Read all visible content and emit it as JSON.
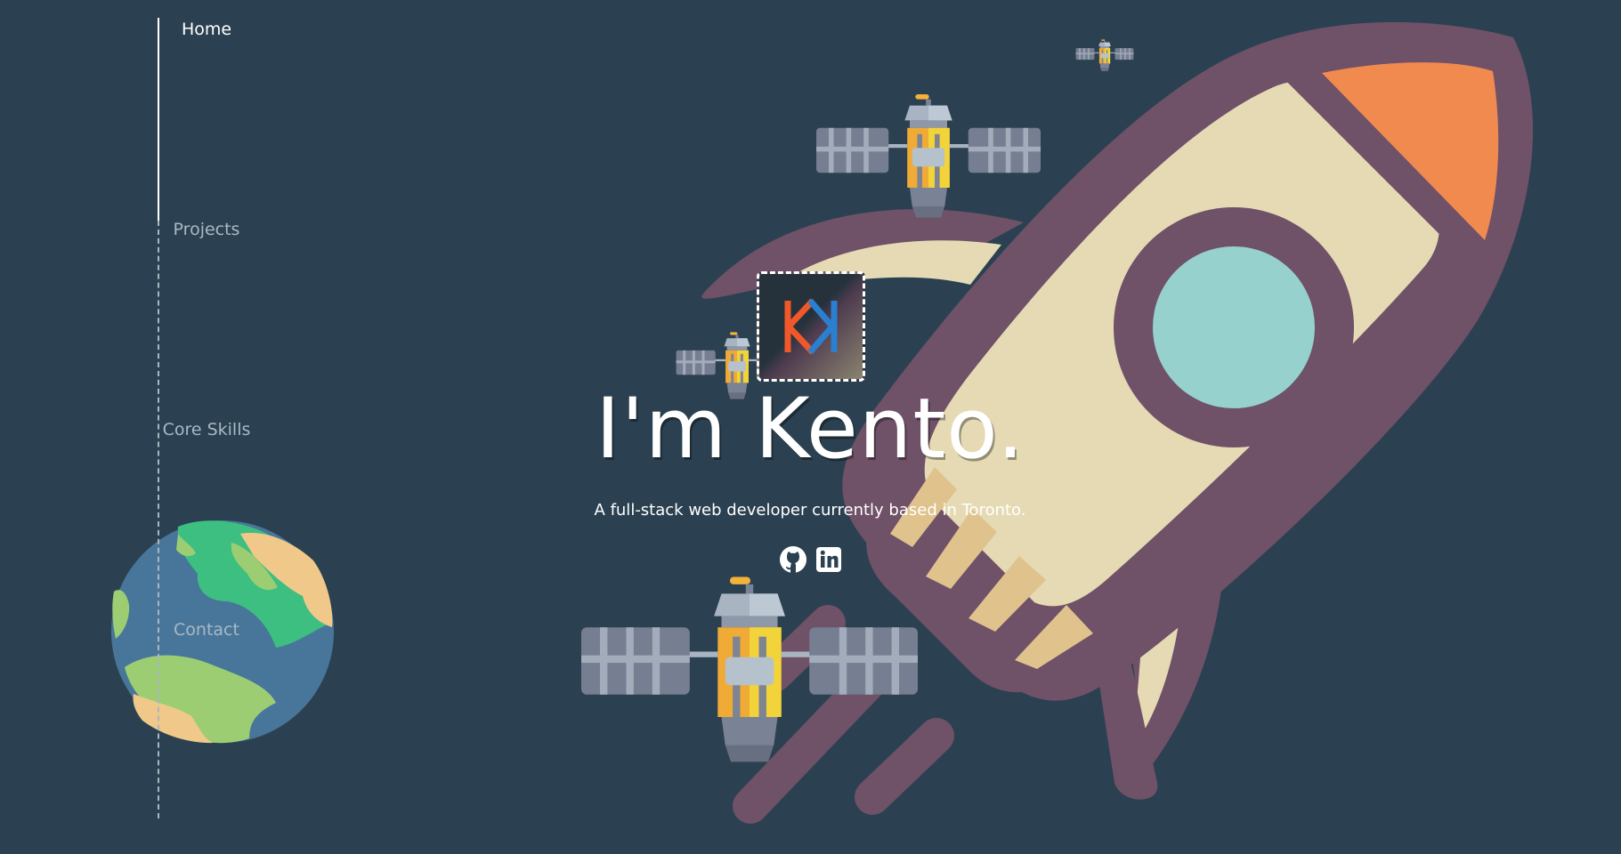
{
  "nav": {
    "items": [
      {
        "label": "Home",
        "active": true
      },
      {
        "label": "Projects",
        "active": false
      },
      {
        "label": "Core Skills",
        "active": false
      },
      {
        "label": "Contact",
        "active": false
      }
    ]
  },
  "hero": {
    "logo_text": "KK",
    "title": "I'm Kento.",
    "subtitle": "A full-stack web developer currently based in Toronto."
  },
  "social": [
    {
      "icon": "github-icon"
    },
    {
      "icon": "linkedin-icon"
    }
  ],
  "colors": {
    "background": "#2b4151",
    "rocket_body": "#6f5168",
    "rocket_cream": "#e5dab4",
    "rocket_window": "#96d1cd",
    "rocket_tip": "#f08a4f",
    "logo_k_orange": "#f0582a",
    "logo_k_blue": "#2a7fd0"
  }
}
